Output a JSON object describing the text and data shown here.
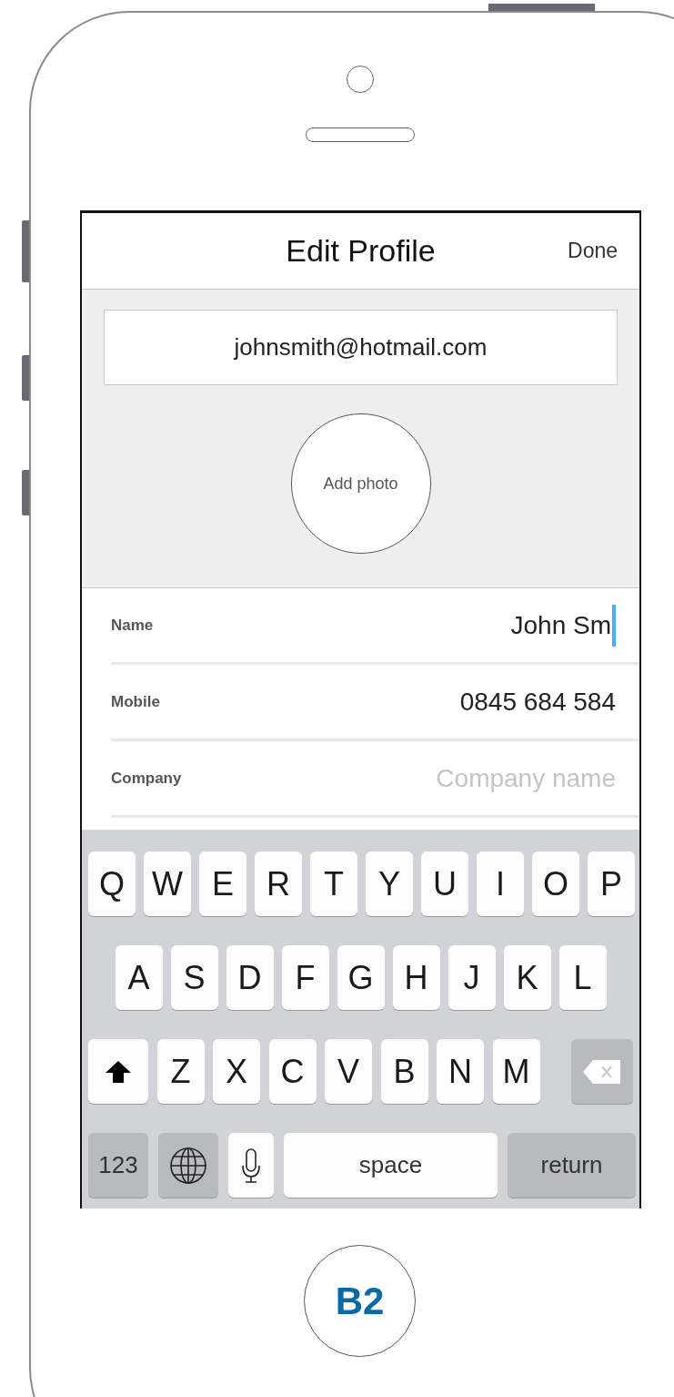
{
  "nav_bar": {
    "title": "Edit Profile",
    "done": "Done"
  },
  "email": {
    "value": "johnsmith@hotmail.com"
  },
  "photo": {
    "label": "Add photo"
  },
  "fields": [
    {
      "label": "Name",
      "value": "John Sm",
      "focused": true
    },
    {
      "label": "Mobile",
      "value": "0845 684 584",
      "focused": false
    },
    {
      "label": "Company",
      "placeholder": "Company name",
      "focused": false
    }
  ],
  "keyboard": [
    [
      {
        "kind": "letter",
        "label": "Q"
      },
      {
        "kind": "letter",
        "label": "W"
      },
      {
        "kind": "letter",
        "label": "E"
      },
      {
        "kind": "letter",
        "label": "R"
      },
      {
        "kind": "letter",
        "label": "T"
      },
      {
        "kind": "letter",
        "label": "Y"
      },
      {
        "kind": "letter",
        "label": "U"
      },
      {
        "kind": "letter",
        "label": "I"
      },
      {
        "kind": "letter",
        "label": "O"
      },
      {
        "kind": "letter",
        "label": "P"
      }
    ],
    [
      {
        "kind": "letter",
        "label": "A"
      },
      {
        "kind": "letter",
        "label": "S"
      },
      {
        "kind": "letter",
        "label": "D"
      },
      {
        "kind": "letter",
        "label": "F"
      },
      {
        "kind": "letter",
        "label": "G"
      },
      {
        "kind": "letter",
        "label": "H"
      },
      {
        "kind": "letter",
        "label": "J"
      },
      {
        "kind": "letter",
        "label": "K"
      },
      {
        "kind": "letter",
        "label": "L"
      }
    ],
    [
      {
        "kind": "shift"
      },
      {
        "kind": "letter",
        "label": "Z"
      },
      {
        "kind": "letter",
        "label": "X"
      },
      {
        "kind": "letter",
        "label": "C"
      },
      {
        "kind": "letter",
        "label": "V"
      },
      {
        "kind": "letter",
        "label": "B"
      },
      {
        "kind": "letter",
        "label": "N"
      },
      {
        "kind": "letter",
        "label": "M"
      },
      {
        "kind": "delete"
      }
    ],
    [
      {
        "kind": "mode",
        "label": "123"
      },
      {
        "kind": "globe"
      },
      {
        "kind": "mic"
      },
      {
        "kind": "space",
        "label": "space"
      },
      {
        "kind": "return",
        "label": "return"
      }
    ]
  ],
  "home_button": {
    "label": "B2"
  }
}
